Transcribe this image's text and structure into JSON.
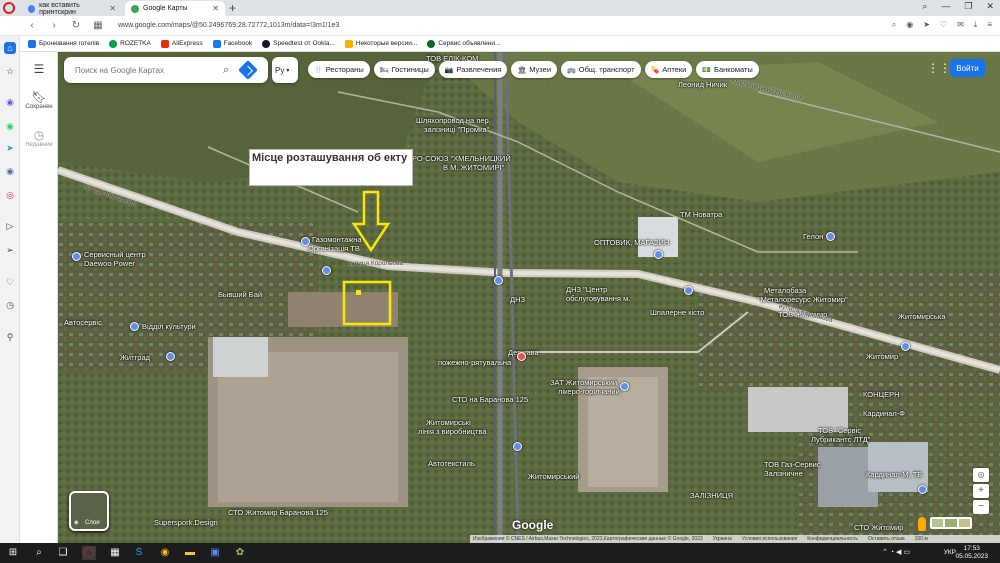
{
  "browser": {
    "tabs": [
      {
        "title": "как вставить принтскрин",
        "favicon_color": "#4285f4"
      },
      {
        "title": "Google Карты",
        "favicon_color": "#34a853"
      }
    ],
    "url": "www.google.com/maps/@50.2496769,28.72772,1013m/data=!3m1!1e3"
  },
  "bookmarks": [
    {
      "label": "Бронювання готелів",
      "color": "#1a73e8"
    },
    {
      "label": "ROZETKA",
      "color": "#00a046"
    },
    {
      "label": "AliExpress",
      "color": "#e62e04"
    },
    {
      "label": "Facebook",
      "color": "#1877f2"
    },
    {
      "label": "Speedtest от Ookla...",
      "color": "#141526"
    },
    {
      "label": "Некоторые версии...",
      "color": "#f4b400"
    },
    {
      "label": "Сервис объявлени...",
      "color": "#0b6623"
    }
  ],
  "sidepanel": {
    "saved_label": "Сохранен",
    "recent_label": "Недавние"
  },
  "search": {
    "placeholder": "Поиск на Google Картах",
    "lang": "Ру"
  },
  "chips": [
    {
      "icon": "🍴",
      "label": "Рестораны"
    },
    {
      "icon": "🛏",
      "label": "Гостиницы"
    },
    {
      "icon": "📷",
      "label": "Развлечения"
    },
    {
      "icon": "🏛",
      "label": "Музеи"
    },
    {
      "icon": "🚌",
      "label": "Общ. транспорт"
    },
    {
      "icon": "💊",
      "label": "Аптеки"
    },
    {
      "icon": "💵",
      "label": "Банкоматы"
    }
  ],
  "signin_label": "Войти",
  "callout_text": "Місце розташування об екту",
  "map_labels": [
    "Леонид Ничик",
    "Шляхопровод на пер.",
    "залізниці \"Промка\"",
    "ТОВ ЕЛІК-КОМ",
    "РО-СОЮЗ \"ХМЕЛЬНИЦКИЙ",
    "В М. ЖИТОМИРІ\"",
    "ТМ Новатра",
    "ОПТОВИК, МАГАЗИН",
    "Гелон",
    "Газомонтажна",
    "Організація ТВ",
    "Сервисный центр",
    "Daewoo Power",
    "Бывший Бай",
    "Автосервіс",
    "Відділ культури",
    "Житград",
    "Держава",
    "пожежно-рятувальна",
    "СТО на Баранова 125",
    "ЗАТ Житомирський",
    "лікеро-горілчаний",
    "Житомирські",
    "лінія з виробництва",
    "Автотекстиль",
    "Житомирський",
    "ДНЗ \"Центр",
    "обслуговування м.",
    "Шпалерне кісто",
    "ТОВ \"Сервіс",
    "Лубрикантс ЛТД\"",
    "ТОВ Газ-Сервис",
    "Залізничне",
    "ЗАЛІЗНИЦЯ",
    "Металобаза",
    "\"Металоресурс Житомир\"",
    "Superspork.Design",
    "СТО Житомир",
    "Житомир",
    "КОНЦЕРН",
    "Кардинал-Ф",
    "Кардинал-М, ТБ",
    "ТОВ Житомир",
    "Житомирська",
    "ДНЗ",
    "СТО Житомир Баранова 125"
  ],
  "road_labels": [
    "вулиця Корольова",
    "вулиця Корольова",
    "вулиця Корольова",
    "Хмельницький провулок"
  ],
  "layers_label": "Слои",
  "google_logo": "Google",
  "attribution": [
    "Изображения © CNES / Airbus,Maxar Technologies, 2023,Картографические данные © Google, 2023",
    "Украина",
    "Условия использования",
    "Конфиденциальность",
    "Оставить отзыв",
    "100 м"
  ],
  "zoom": {
    "in": "+",
    "out": "−"
  },
  "taskbar": {
    "time": "17:53",
    "date": "05.05.2023",
    "lang": "УКР"
  }
}
